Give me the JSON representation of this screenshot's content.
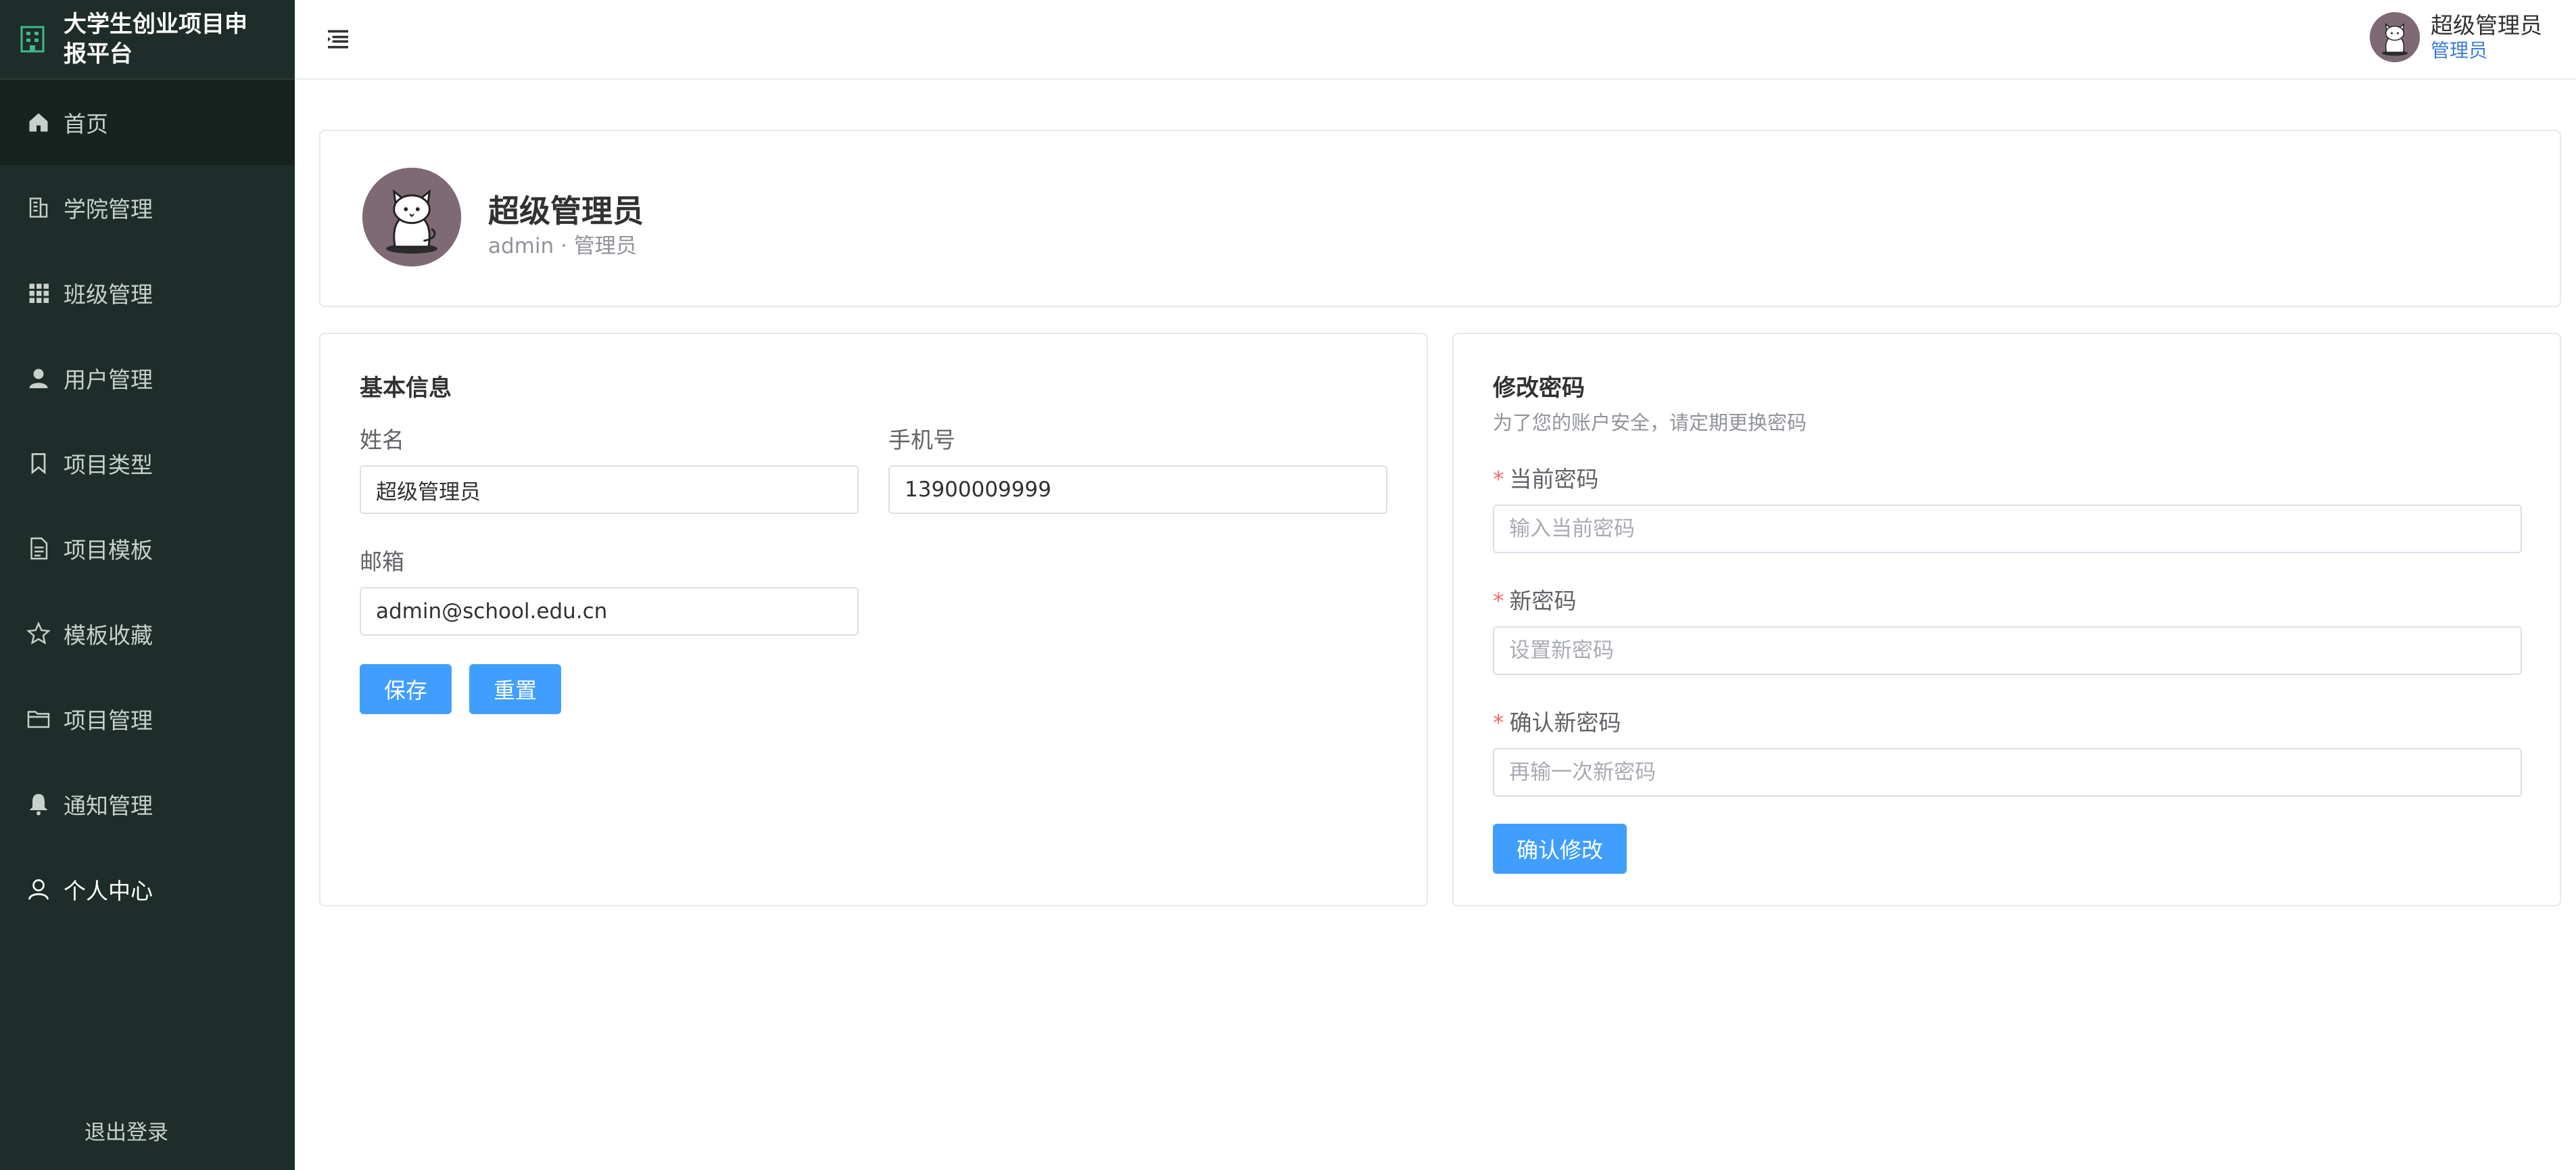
{
  "app": {
    "title": "大学生创业项目申报平台"
  },
  "sidebar": {
    "items": [
      {
        "label": "首页",
        "icon": "home-icon"
      },
      {
        "label": "学院管理",
        "icon": "building-icon"
      },
      {
        "label": "班级管理",
        "icon": "grid-icon"
      },
      {
        "label": "用户管理",
        "icon": "user-icon"
      },
      {
        "label": "项目类型",
        "icon": "bookmark-icon"
      },
      {
        "label": "项目模板",
        "icon": "document-icon"
      },
      {
        "label": "模板收藏",
        "icon": "star-icon"
      },
      {
        "label": "项目管理",
        "icon": "folder-icon"
      },
      {
        "label": "通知管理",
        "icon": "bell-icon"
      },
      {
        "label": "个人中心",
        "icon": "user-outline-icon"
      }
    ],
    "logout": "退出登录"
  },
  "header": {
    "user_name": "超级管理员",
    "user_role": "管理员"
  },
  "profile": {
    "name": "超级管理员",
    "subtitle": "admin · 管理员"
  },
  "basic_info": {
    "title": "基本信息",
    "name_label": "姓名",
    "name_value": "超级管理员",
    "phone_label": "手机号",
    "phone_value": "13900009999",
    "email_label": "邮箱",
    "email_value": "admin@school.edu.cn",
    "save_label": "保存",
    "reset_label": "重置"
  },
  "password": {
    "title": "修改密码",
    "hint": "为了您的账户安全，请定期更换密码",
    "current_label": "当前密码",
    "current_placeholder": "输入当前密码",
    "new_label": "新密码",
    "new_placeholder": "设置新密码",
    "confirm_label": "确认新密码",
    "confirm_placeholder": "再输一次新密码",
    "submit_label": "确认修改"
  },
  "colors": {
    "sidebar_bg": "#1f2d2a",
    "primary": "#409eff",
    "required": "#f56c6c",
    "brand_icon": "#3fb88f"
  }
}
